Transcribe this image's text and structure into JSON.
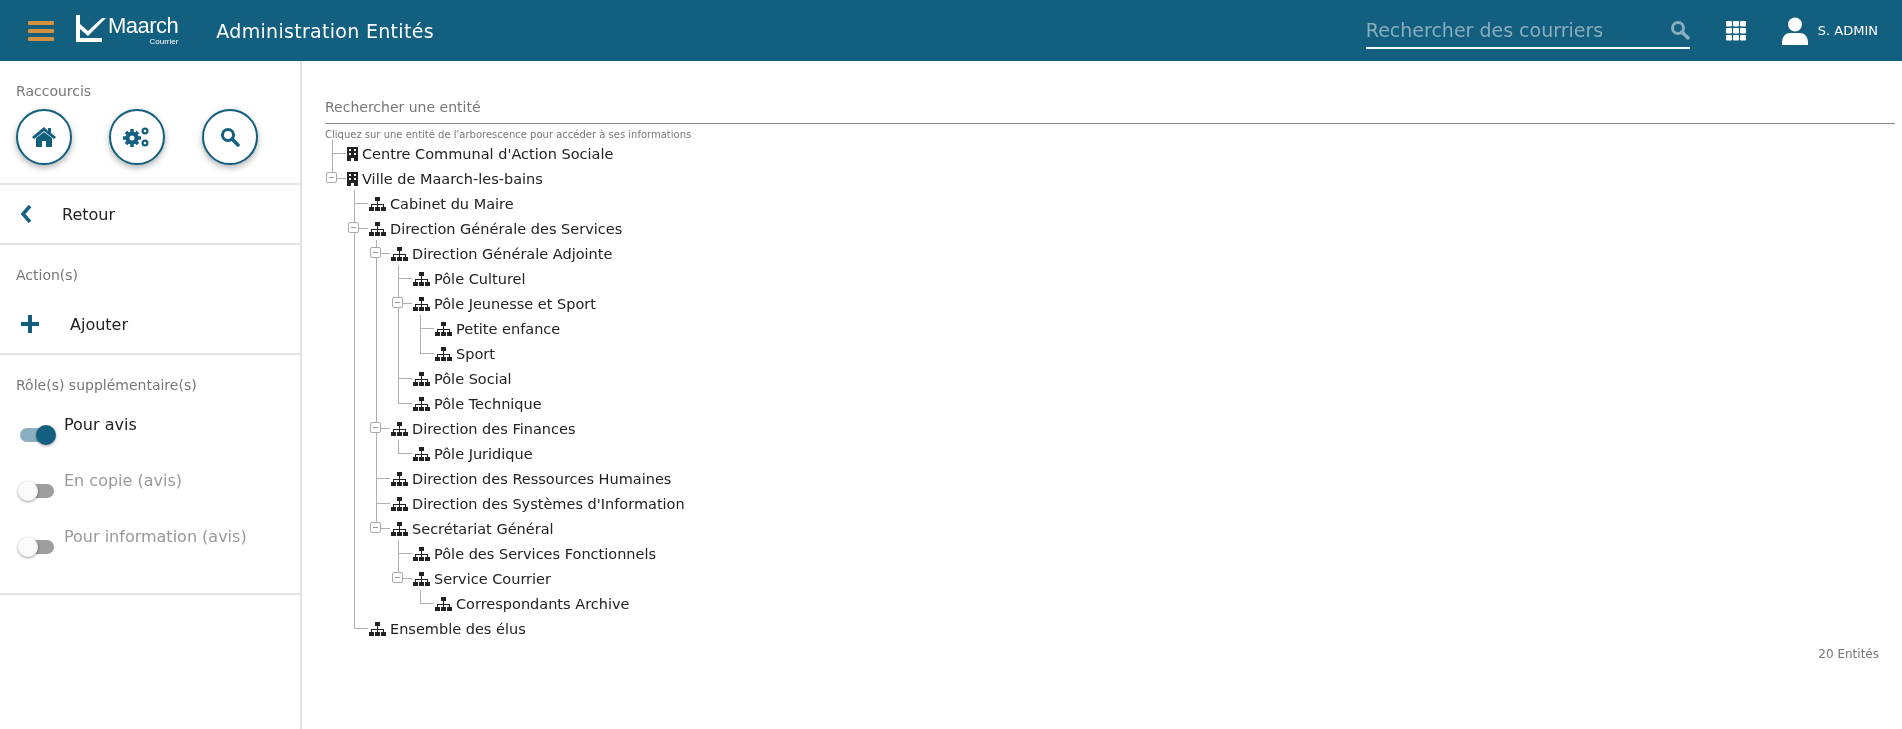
{
  "header": {
    "app_name": "Maarch",
    "app_subtitle": "Courrier",
    "title": "Administration Entités",
    "search": {
      "placeholder": "Rechercher des courriers"
    },
    "user": "S. ADMIN"
  },
  "sidebar": {
    "shortcuts_title": "Raccourcis",
    "back": "Retour",
    "actions_title": "Action(s)",
    "actions": [
      {
        "label": "Ajouter"
      }
    ],
    "roles_title": "Rôle(s) supplémentaire(s)",
    "roles": [
      {
        "label": "Pour avis",
        "on": true
      },
      {
        "label": "En copie (avis)",
        "on": false
      },
      {
        "label": "Pour information (avis)",
        "on": false
      }
    ]
  },
  "main": {
    "search": {
      "placeholder": "Rechercher une entité"
    },
    "hint": "Cliquez sur une entité de l'arborescence pour accéder à ses informations",
    "tree": [
      {
        "label": "Centre Communal d'Action Sociale",
        "kind": "building"
      },
      {
        "label": "Ville de Maarch-les-bains",
        "kind": "building",
        "expanded": true,
        "children": [
          {
            "label": "Cabinet du Maire",
            "kind": "unit"
          },
          {
            "label": "Direction Générale des Services",
            "kind": "unit",
            "expanded": true,
            "children": [
              {
                "label": "Direction Générale Adjointe",
                "kind": "unit",
                "expanded": true,
                "children": [
                  {
                    "label": "Pôle Culturel",
                    "kind": "unit"
                  },
                  {
                    "label": "Pôle Jeunesse et Sport",
                    "kind": "unit",
                    "expanded": true,
                    "children": [
                      {
                        "label": "Petite enfance",
                        "kind": "unit"
                      },
                      {
                        "label": "Sport",
                        "kind": "unit"
                      }
                    ]
                  },
                  {
                    "label": "Pôle Social",
                    "kind": "unit"
                  },
                  {
                    "label": "Pôle Technique",
                    "kind": "unit"
                  }
                ]
              },
              {
                "label": "Direction des Finances",
                "kind": "unit",
                "expanded": true,
                "children": [
                  {
                    "label": "Pôle Juridique",
                    "kind": "unit"
                  }
                ]
              },
              {
                "label": "Direction des Ressources Humaines",
                "kind": "unit"
              },
              {
                "label": "Direction des Systèmes d'Information",
                "kind": "unit"
              },
              {
                "label": "Secrétariat Général",
                "kind": "unit",
                "expanded": true,
                "children": [
                  {
                    "label": "Pôle des Services Fonctionnels",
                    "kind": "unit"
                  },
                  {
                    "label": "Service Courrier",
                    "kind": "unit",
                    "expanded": true,
                    "children": [
                      {
                        "label": "Correspondants Archive",
                        "kind": "unit"
                      }
                    ]
                  }
                ]
              }
            ]
          },
          {
            "label": "Ensemble des élus",
            "kind": "unit"
          }
        ]
      }
    ],
    "count": "20 Entités"
  }
}
